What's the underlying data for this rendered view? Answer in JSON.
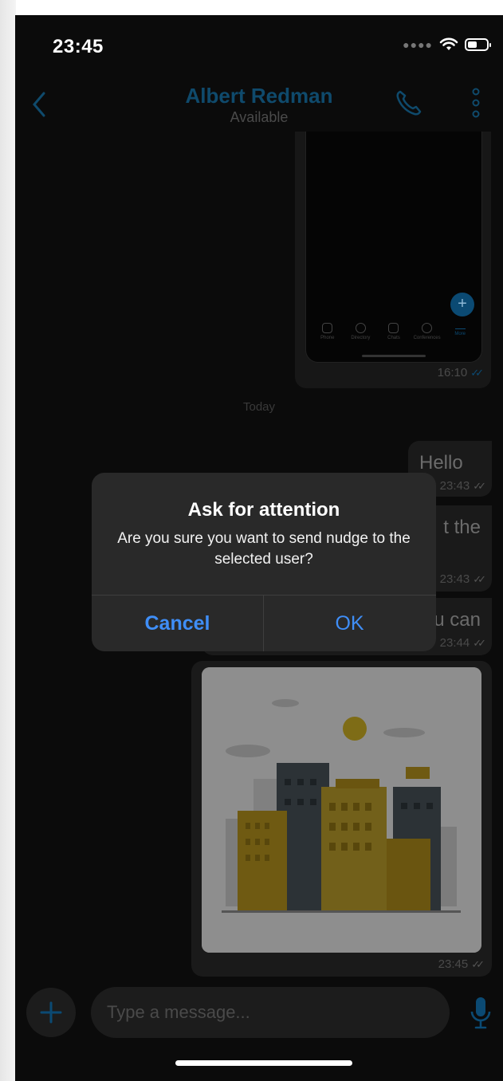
{
  "status_bar": {
    "time": "23:45"
  },
  "header": {
    "contact_name": "Albert Redman",
    "contact_status": "Available"
  },
  "screenshot_message": {
    "mini_tabs": [
      "Phone",
      "Directory",
      "Chats",
      "Conferences",
      "More"
    ],
    "time": "16:10"
  },
  "date_separator": "Today",
  "messages": [
    {
      "text": "Hello",
      "time": "23:43"
    },
    {
      "text": "t the",
      "time": "23:43"
    },
    {
      "text": "u can",
      "time": "23:44"
    }
  ],
  "image_message": {
    "time": "23:45"
  },
  "composer": {
    "placeholder": "Type a message..."
  },
  "dialog": {
    "title": "Ask for attention",
    "message": "Are you sure you want to send nudge to the selected user?",
    "cancel_label": "Cancel",
    "ok_label": "OK"
  },
  "colors": {
    "accent": "#0b4a73",
    "dialog_button": "#3f8ef7",
    "background": "#0b0b0b"
  },
  "icons": [
    "back-icon",
    "phone-icon",
    "more-vertical-icon",
    "wifi-icon",
    "battery-icon",
    "plus-icon",
    "microphone-icon",
    "double-check-icon"
  ]
}
